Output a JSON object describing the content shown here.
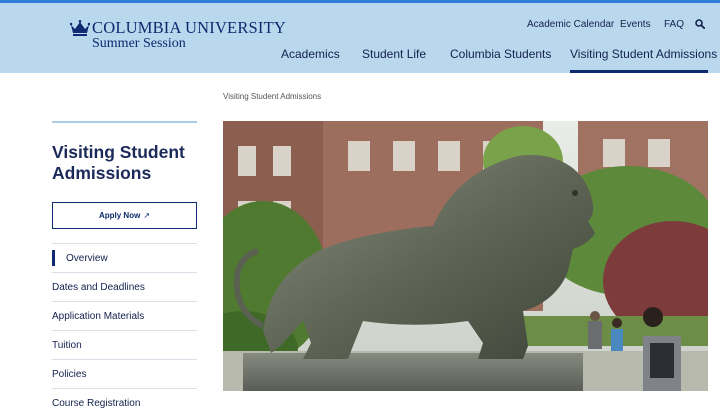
{
  "header": {
    "university": "COLUMBIA UNIVERSITY",
    "school": "Summer Session",
    "utility_links": [
      "Academic Calendar",
      "Events",
      "FAQ"
    ],
    "nav": [
      "Academics",
      "Student Life",
      "Columbia Students",
      "Visiting Student Admissions"
    ],
    "active_nav": "Visiting Student Admissions"
  },
  "breadcrumb": "Visiting Student Admissions",
  "sidebar": {
    "title": "Visiting Student Admissions",
    "apply_label": "Apply Now",
    "items": [
      "Overview",
      "Dates and Deadlines",
      "Application Materials",
      "Tuition",
      "Policies",
      "Course Registration"
    ],
    "active_item": "Overview"
  },
  "colors": {
    "header_bg": "#b9d8ee",
    "brand_navy": "#0d2a6e",
    "accent_blue": "#2f7ed8"
  }
}
